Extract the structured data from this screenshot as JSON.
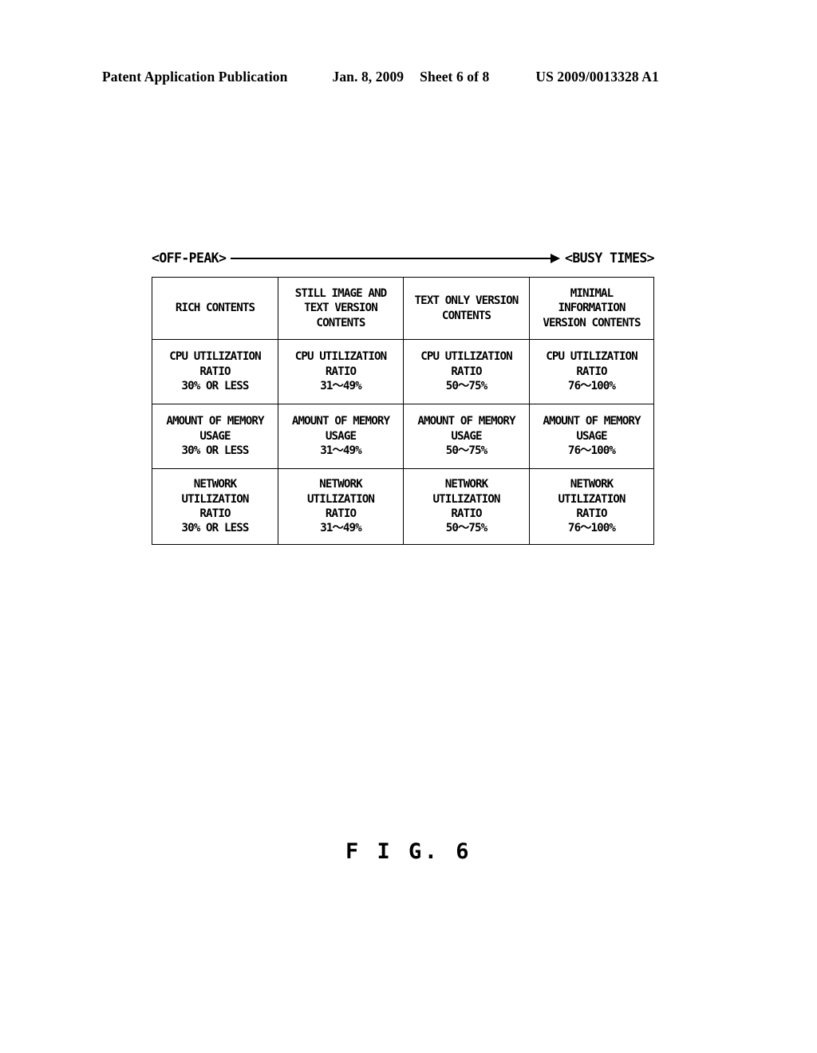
{
  "header": {
    "publication": "Patent Application Publication",
    "date": "Jan. 8, 2009",
    "sheet": "Sheet 6 of 8",
    "patent_number": "US 2009/0013328 A1"
  },
  "figure": {
    "caption": "F I G.  6",
    "axis": {
      "left_label": "<OFF-PEAK>",
      "right_label": "<BUSY TIMES>",
      "arrow_direction": "right"
    },
    "table": {
      "columns": [
        {
          "header": [
            "RICH CONTENTS"
          ],
          "cpu": [
            "CPU UTILIZATION",
            "RATIO",
            "30% OR LESS"
          ],
          "memory": [
            "AMOUNT OF MEMORY",
            "USAGE",
            "30% OR LESS"
          ],
          "network": [
            "NETWORK",
            "UTILIZATION",
            "RATIO",
            "30% OR LESS"
          ]
        },
        {
          "header": [
            "STILL IMAGE AND",
            "TEXT VERSION",
            "CONTENTS"
          ],
          "cpu": [
            "CPU UTILIZATION",
            "RATIO",
            "31〜49%"
          ],
          "memory": [
            "AMOUNT OF MEMORY",
            "USAGE",
            "31〜49%"
          ],
          "network": [
            "NETWORK",
            "UTILIZATION",
            "RATIO",
            "31〜49%"
          ]
        },
        {
          "header": [
            "TEXT ONLY VERSION",
            "CONTENTS"
          ],
          "cpu": [
            "CPU UTILIZATION",
            "RATIO",
            "50〜75%"
          ],
          "memory": [
            "AMOUNT OF MEMORY",
            "USAGE",
            "50〜75%"
          ],
          "network": [
            "NETWORK",
            "UTILIZATION",
            "RATIO",
            "50〜75%"
          ]
        },
        {
          "header": [
            "MINIMAL",
            "INFORMATION",
            "VERSION CONTENTS"
          ],
          "cpu": [
            "CPU UTILIZATION",
            "RATIO",
            "76〜100%"
          ],
          "memory": [
            "AMOUNT OF MEMORY",
            "USAGE",
            "76〜100%"
          ],
          "network": [
            "NETWORK",
            "UTILIZATION",
            "RATIO",
            "76〜100%"
          ]
        }
      ]
    }
  }
}
